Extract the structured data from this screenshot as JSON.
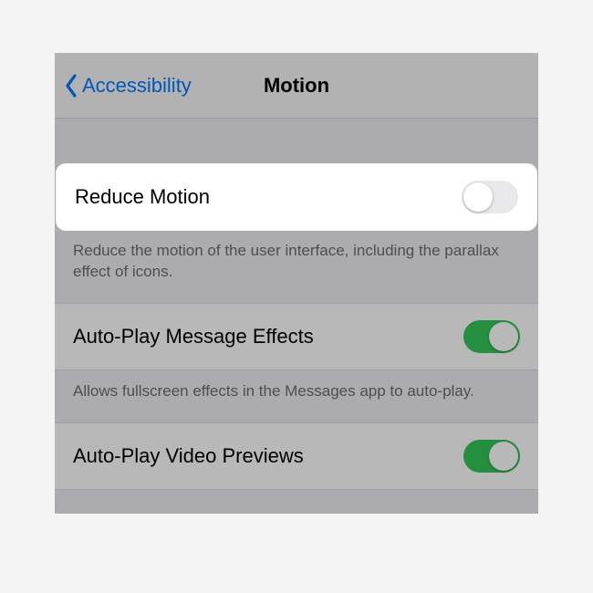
{
  "nav": {
    "back_label": "Accessibility",
    "title": "Motion"
  },
  "rows": {
    "reduce_motion": {
      "label": "Reduce Motion",
      "on": false,
      "highlighted": true,
      "footer": "Reduce the motion of the user interface, including the parallax effect of icons."
    },
    "auto_play_message_effects": {
      "label": "Auto-Play Message Effects",
      "on": true,
      "footer": "Allows fullscreen effects in the Messages app to auto-play."
    },
    "auto_play_video_previews": {
      "label": "Auto-Play Video Previews",
      "on": true
    }
  },
  "colors": {
    "tint": "#007aff",
    "switch_on": "#34c759",
    "switch_off": "#e9e9eb"
  }
}
